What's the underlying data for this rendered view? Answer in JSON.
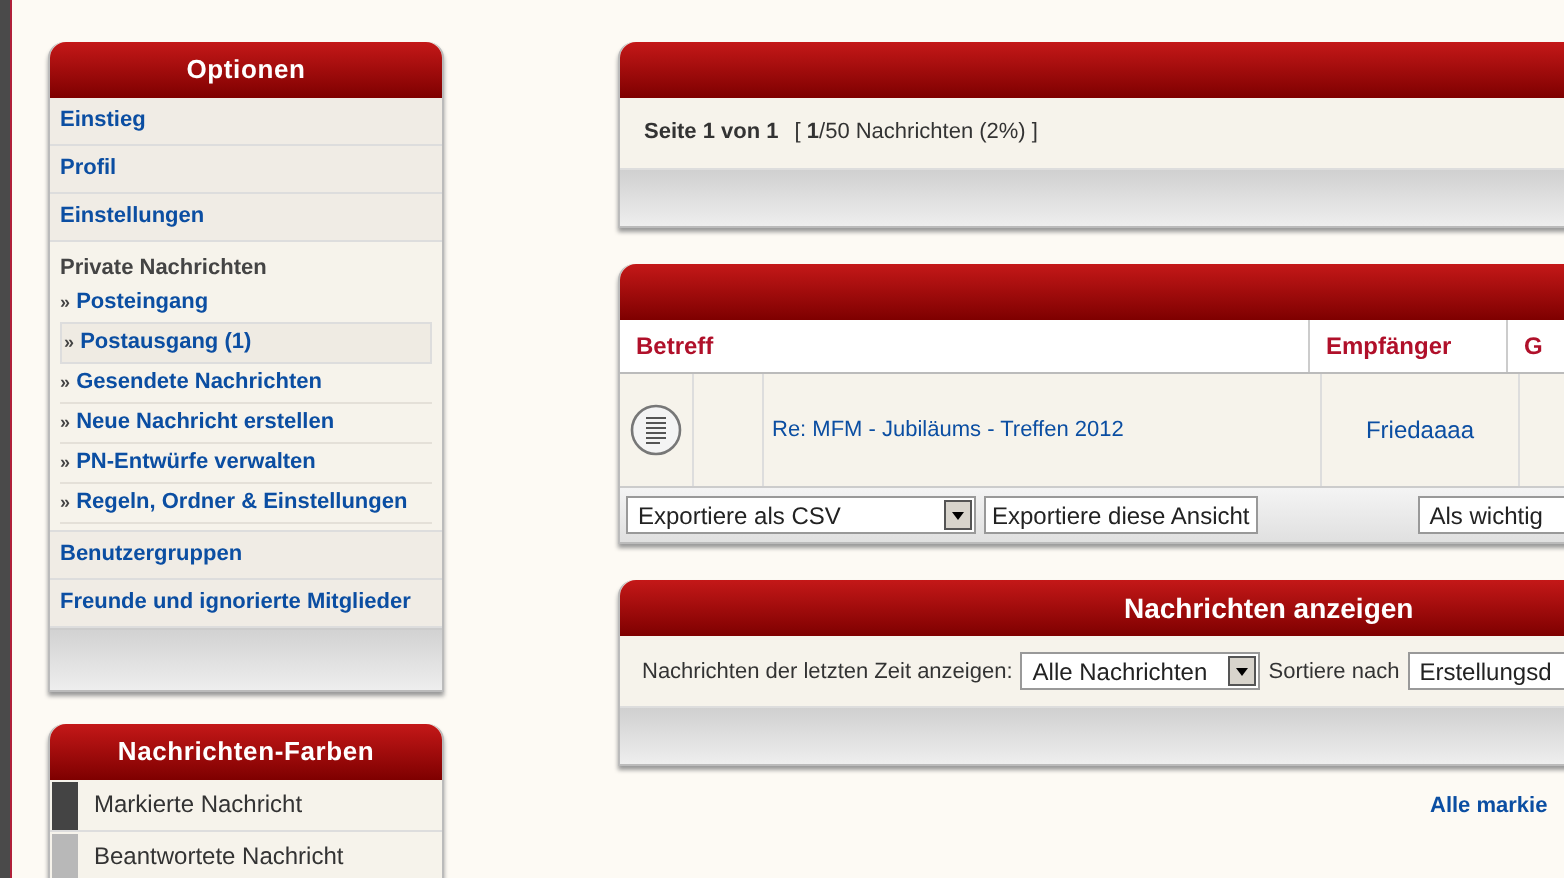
{
  "options_panel": {
    "title": "Optionen",
    "items": [
      {
        "kind": "link",
        "label": "Einstieg"
      },
      {
        "kind": "link",
        "label": "Profil"
      },
      {
        "kind": "link",
        "label": "Einstellungen"
      },
      {
        "kind": "section",
        "label": "Private Nachrichten",
        "children": [
          {
            "bullet": "»",
            "label": "Posteingang",
            "selected": false
          },
          {
            "bullet": "»",
            "label": "Postausgang (1)",
            "selected": true
          },
          {
            "bullet": "»",
            "label": "Gesendete Nachrichten",
            "selected": false
          },
          {
            "bullet": "»",
            "label": "Neue Nachricht erstellen",
            "selected": false
          },
          {
            "bullet": "»",
            "label": "PN-Entwürfe verwalten",
            "selected": false
          },
          {
            "bullet": "»",
            "label": "Regeln, Ordner & Einstellungen",
            "selected": false
          }
        ]
      },
      {
        "kind": "link",
        "label": "Benutzergruppen"
      },
      {
        "kind": "link",
        "label": "Freunde und ignorierte Mitglieder"
      }
    ]
  },
  "colors_panel": {
    "title": "Nachrichten-Farben",
    "items": [
      {
        "label": "Markierte Nachricht",
        "color": "#444444"
      },
      {
        "label": "Beantwortete Nachricht",
        "color": "#b8b8b8"
      }
    ]
  },
  "pagination": {
    "text": "Seite 1 von 1",
    "count": "[ **1**/50 Nachrichten (2%) ]"
  },
  "messages_table": {
    "columns": [
      "Betreff",
      "Empfänger",
      "G"
    ],
    "rows": [
      {
        "subject": "Re: MFM - Jubiläums - Treffen 2012",
        "recipient": "Friedaaaa"
      }
    ],
    "export_select": "Exportiere als CSV",
    "export_button": "Exportiere diese Ansicht",
    "mark_select": "Als wichtig"
  },
  "view_panel": {
    "title": "Nachrichten anzeigen",
    "period_label": "Nachrichten der letzten Zeit anzeigen:",
    "period_select": "Alle Nachrichten",
    "sort_label": "Sortiere nach",
    "sort_select": "Erstellungsd"
  },
  "mark_all_link": "Alle markie"
}
